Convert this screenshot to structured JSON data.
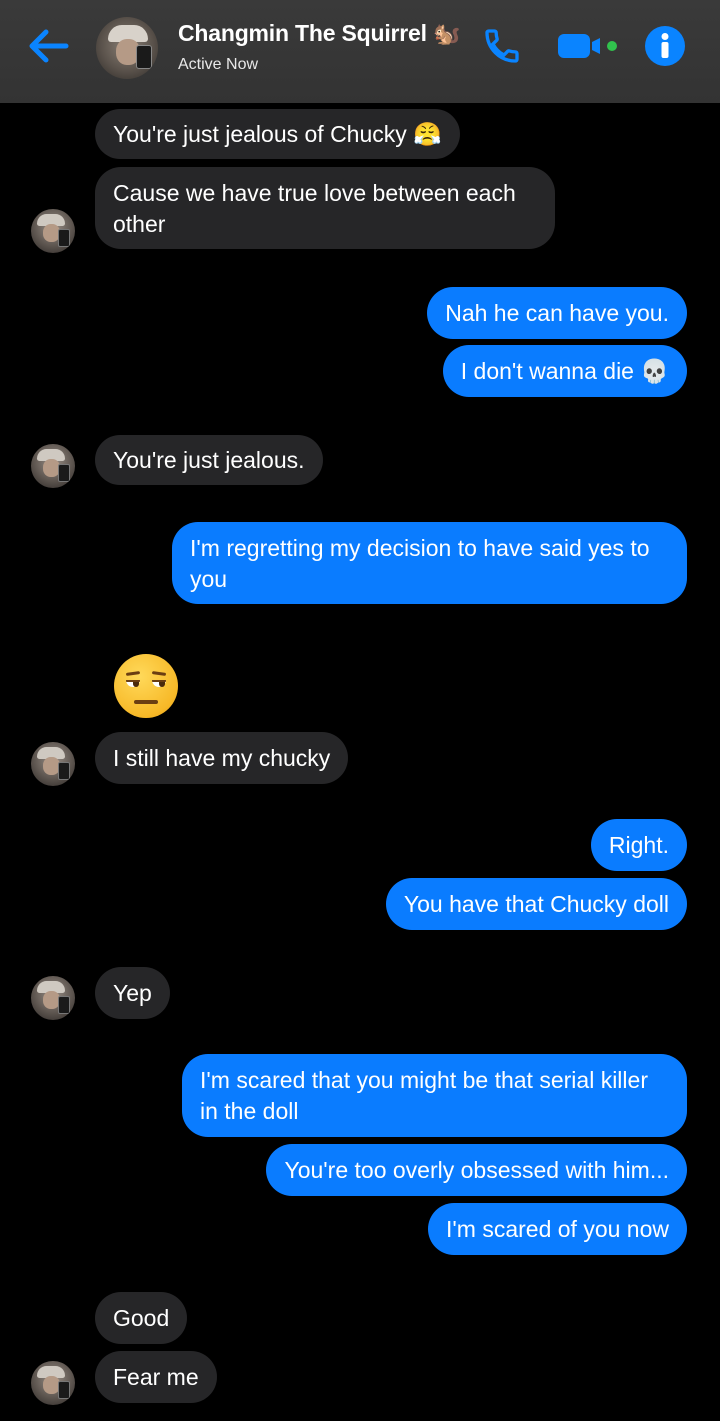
{
  "header": {
    "contact_name": "Changmin The Squirrel",
    "name_emoji": "🐿️",
    "status": "Active Now",
    "icons": [
      "back-arrow-icon",
      "phone-icon",
      "video-camera-icon",
      "info-icon"
    ],
    "accent_color": "#0a7cff"
  },
  "messages": [
    {
      "from": "them",
      "text": "You're just jealous of Chucky 😤"
    },
    {
      "from": "them",
      "text": "Cause we have true love between each other"
    },
    {
      "from": "me",
      "text": "Nah he can have you."
    },
    {
      "from": "me",
      "text": "I don't wanna die 💀"
    },
    {
      "from": "them",
      "text": "You're just jealous."
    },
    {
      "from": "me",
      "text": "I'm regretting my decision to have said yes to you"
    },
    {
      "from": "them",
      "text": "😒"
    },
    {
      "from": "them",
      "text": "I still have my chucky"
    },
    {
      "from": "me",
      "text": "Right."
    },
    {
      "from": "me",
      "text": "You have that Chucky doll"
    },
    {
      "from": "them",
      "text": "Yep"
    },
    {
      "from": "me",
      "text": "I'm scared that you might be that serial killer in the doll"
    },
    {
      "from": "me",
      "text": "You're too overly obsessed with him..."
    },
    {
      "from": "me",
      "text": "I'm scared of you now"
    },
    {
      "from": "them",
      "text": "Good"
    },
    {
      "from": "them",
      "text": "Fear me"
    }
  ]
}
